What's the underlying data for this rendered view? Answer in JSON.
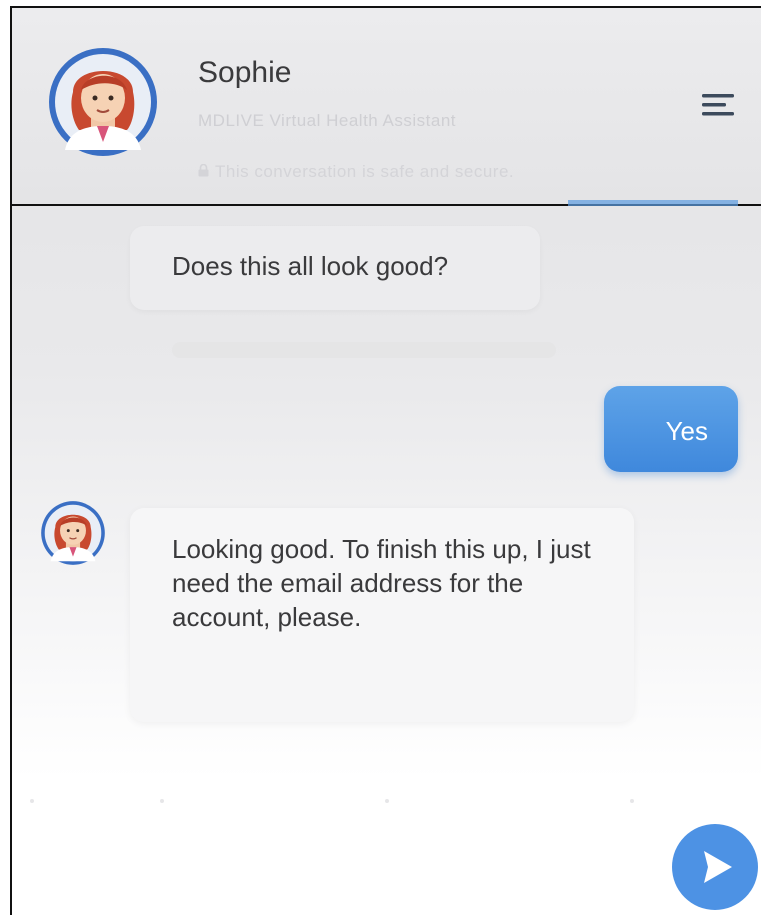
{
  "header": {
    "assistant_name": "Sophie",
    "subtitle": "MDLIVE Virtual Health Assistant",
    "secure_note": "This conversation is safe and secure."
  },
  "messages": [
    {
      "sender": "bot",
      "text": "Does this all look good?"
    },
    {
      "sender": "user",
      "text": "Yes"
    },
    {
      "sender": "bot",
      "text": "Looking good. To finish this up, I just need the email address for the account, please."
    }
  ],
  "icons": {
    "avatar": "doctor-avatar-icon",
    "menu": "menu-icon",
    "lock": "lock-icon",
    "send": "send-icon"
  },
  "colors": {
    "accent": "#4d92e4",
    "user_bubble": "#4f95e2",
    "bot_bubble": "#ececee",
    "text": "#3a3a3c"
  }
}
